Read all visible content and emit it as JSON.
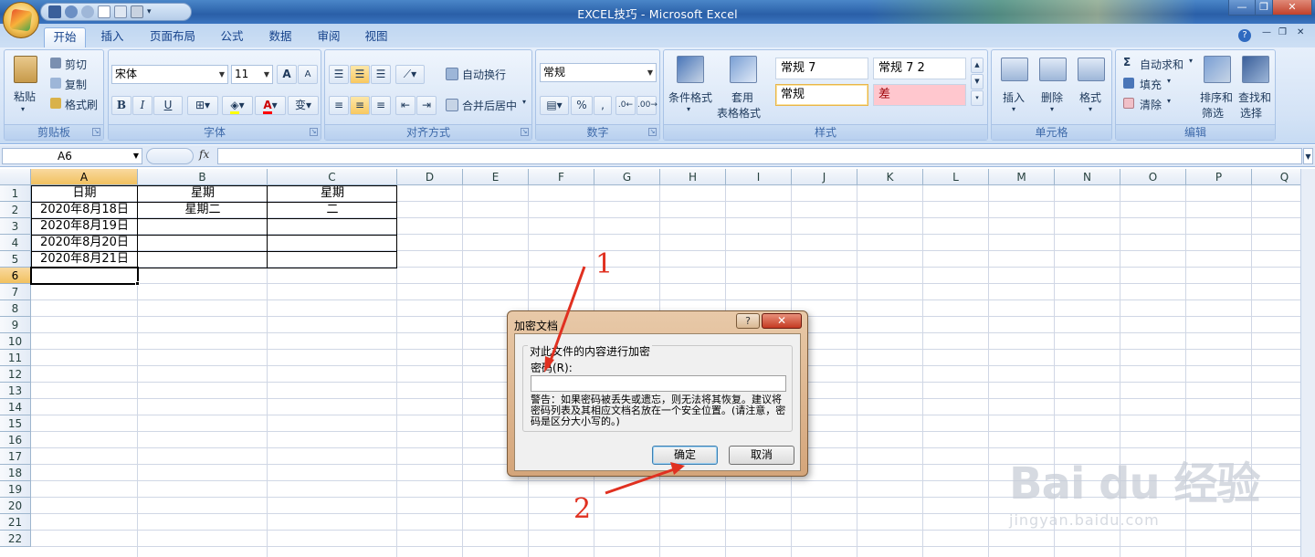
{
  "window": {
    "title": "EXCEL技巧 - Microsoft Excel",
    "controls": {
      "minimize": "—",
      "restore": "❐",
      "close": "✕"
    }
  },
  "tabs": [
    "开始",
    "插入",
    "页面布局",
    "公式",
    "数据",
    "审阅",
    "视图"
  ],
  "active_tab": "开始",
  "ribbon": {
    "clipboard": {
      "group": "剪贴板",
      "paste": "粘贴",
      "cut": "剪切",
      "copy": "复制",
      "format_painter": "格式刷"
    },
    "font": {
      "group": "字体",
      "font_name": "宋体",
      "font_size": "11",
      "bold": "B",
      "italic": "I",
      "underline": "U",
      "grow": "A",
      "shrink": "A",
      "phonetic": "变"
    },
    "alignment": {
      "group": "对齐方式",
      "wrap_text": "自动换行",
      "merge_center": "合并后居中"
    },
    "number": {
      "group": "数字",
      "format": "常规",
      "percent": "%",
      "comma": ","
    },
    "styles": {
      "group": "样式",
      "conditional_format": "条件格式",
      "format_as_table_line1": "套用",
      "format_as_table_line2": "表格格式",
      "cells": [
        "常规 7",
        "常规 7 2",
        "常规",
        "差"
      ]
    },
    "cells": {
      "group": "单元格",
      "insert": "插入",
      "delete": "删除",
      "format": "格式"
    },
    "editing": {
      "group": "编辑",
      "autosum": "自动求和",
      "fill": "填充",
      "clear": "清除",
      "sort_line1": "排序和",
      "sort_line2": "筛选",
      "find_line1": "查找和",
      "find_line2": "选择"
    }
  },
  "formula_bar": {
    "name_box": "A6",
    "fx": "fx",
    "formula": ""
  },
  "sheet": {
    "columns": [
      "A",
      "B",
      "C",
      "D",
      "E",
      "F",
      "G",
      "H",
      "I",
      "J",
      "K",
      "L",
      "M",
      "N",
      "O",
      "P",
      "Q"
    ],
    "rows": [
      "1",
      "2",
      "3",
      "4",
      "5",
      "6",
      "7",
      "8",
      "9",
      "10",
      "11",
      "12",
      "13",
      "14",
      "15",
      "16",
      "17",
      "18",
      "19",
      "20",
      "21",
      "22"
    ],
    "selected_column": "A",
    "selected_row": "6",
    "cells": {
      "A1": "日期",
      "B1": "星期",
      "C1": "星期",
      "A2": "2020年8月18日",
      "B2": "星期二",
      "C2": "二",
      "A3": "2020年8月19日",
      "A4": "2020年8月20日",
      "A5": "2020年8月21日"
    }
  },
  "dialog": {
    "title": "加密文档",
    "help": "?",
    "close": "✕",
    "group_label": "对此文件的内容进行加密",
    "password_label": "密码(R):",
    "password_value": "",
    "warning": "警告：如果密码被丢失或遗忘，则无法将其恢复。建议将密码列表及其相应文档名放在一个安全位置。(请注意，密码是区分大小写的。)",
    "ok": "确定",
    "cancel": "取消"
  },
  "annotations": {
    "marker1": "1",
    "marker2": "2",
    "color": "#e03020"
  },
  "watermark": {
    "brand": "Bai du 经验",
    "url": "jingyan.baidu.com"
  }
}
